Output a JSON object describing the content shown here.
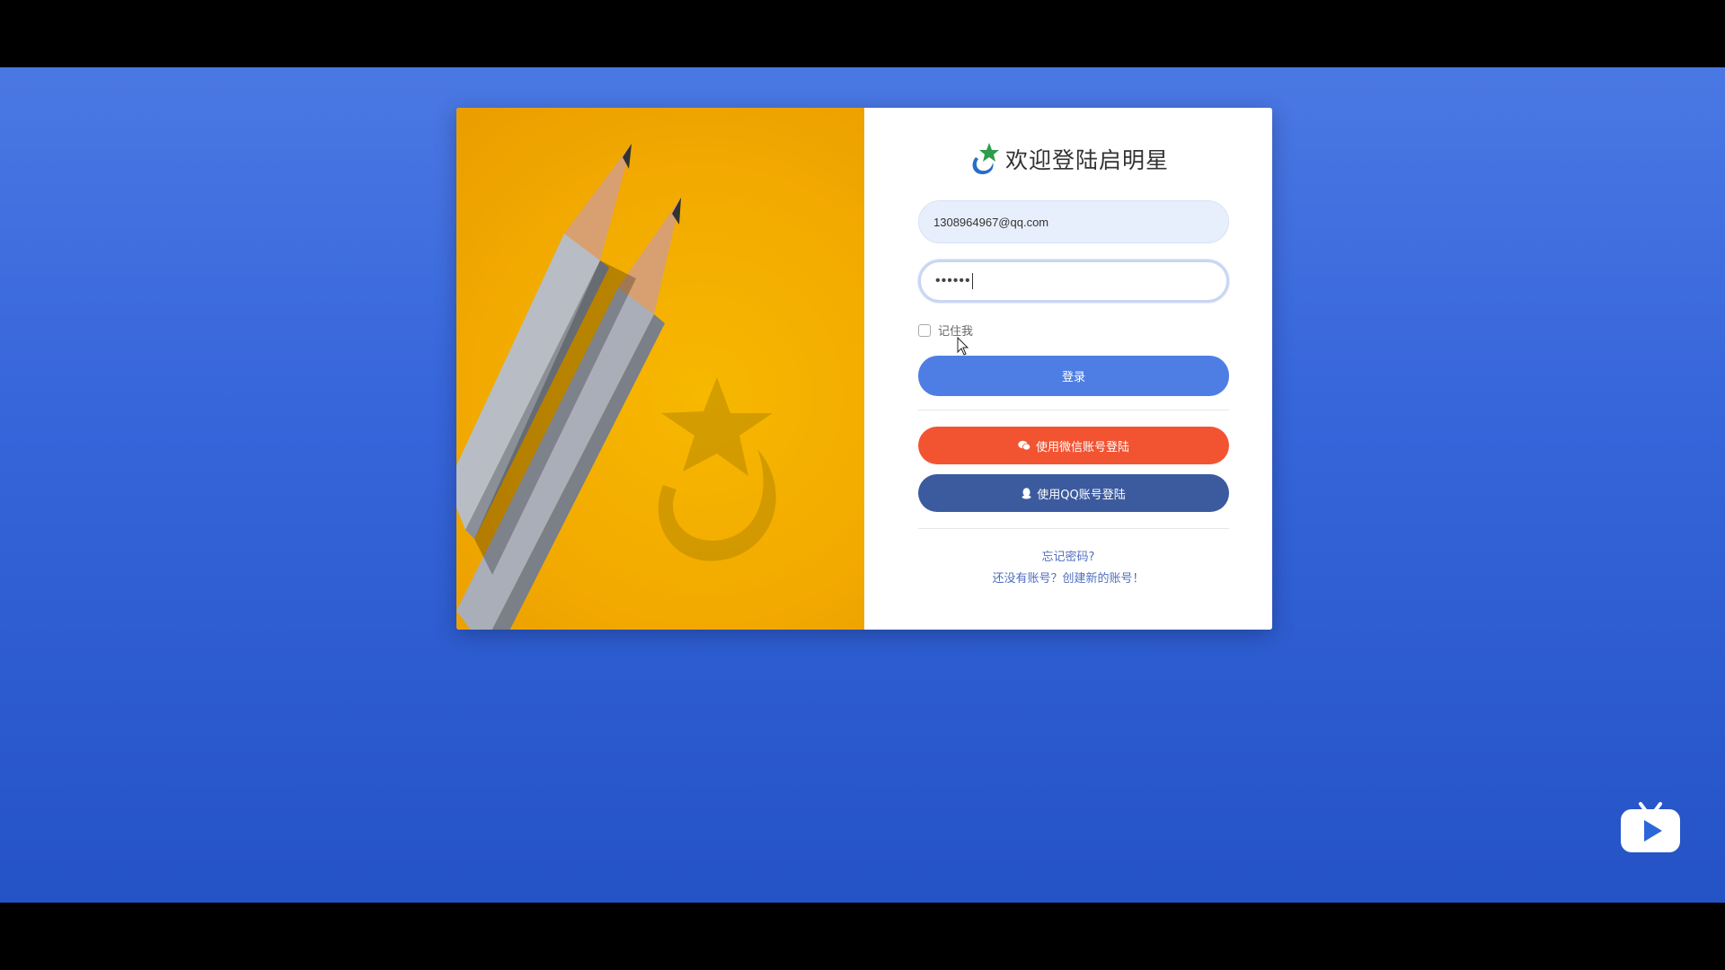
{
  "brand": {
    "title": "欢迎登陆启明星",
    "logo_icon": "shooting-star-icon"
  },
  "form": {
    "email_value": "1308964967@qq.com",
    "password_mask": "••••••",
    "remember_label": "记住我",
    "remember_checked": false,
    "login_label": "登录",
    "wechat_label": "使用微信账号登陆",
    "wechat_icon": "wechat-icon",
    "qq_label": "使用QQ账号登陆",
    "qq_icon": "qq-icon",
    "forgot_label": "忘记密码?",
    "register_label": "还没有账号？创建新的账号！"
  },
  "colors": {
    "background": "#3766db",
    "login_button": "#4e7ee4",
    "wechat_button": "#f25432",
    "qq_button": "#3c5a9e",
    "hero_yellow": "#f2a900"
  },
  "overlay": {
    "video_logo_icon": "tv-play-icon"
  }
}
